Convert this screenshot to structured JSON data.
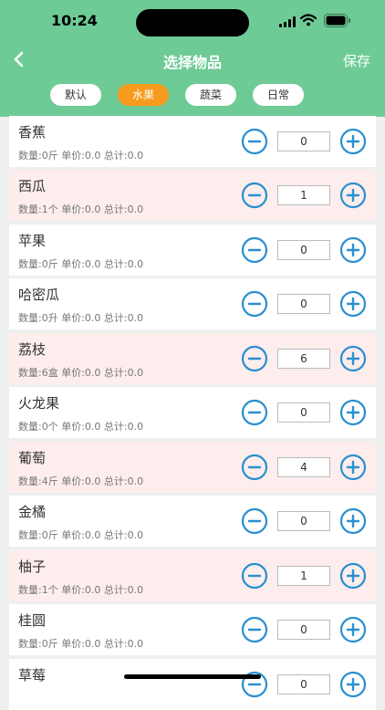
{
  "status": {
    "time": "10:24"
  },
  "nav": {
    "title": "选择物品",
    "save_label": "保存"
  },
  "tabs": [
    {
      "label": "默认",
      "active": false
    },
    {
      "label": "水果",
      "active": true
    },
    {
      "label": "蔬菜",
      "active": false
    },
    {
      "label": "日常",
      "active": false
    }
  ],
  "colors": {
    "header": "#6fcb96",
    "active_tab": "#f79b1e",
    "highlight_row": "#fdeded",
    "stepper": "#2a8fd0"
  },
  "items": [
    {
      "name": "香蕉",
      "info": "数量:0斤 单价:0.0 总计:0.0",
      "qty": "0",
      "highlight": false
    },
    {
      "name": "西瓜",
      "info": "数量:1个 单价:0.0 总计:0.0",
      "qty": "1",
      "highlight": true
    },
    {
      "name": "苹果",
      "info": "数量:0斤 单价:0.0 总计:0.0",
      "qty": "0",
      "highlight": false
    },
    {
      "name": "哈密瓜",
      "info": "数量:0升 单价:0.0 总计:0.0",
      "qty": "0",
      "highlight": false
    },
    {
      "name": "荔枝",
      "info": "数量:6盒 单价:0.0 总计:0.0",
      "qty": "6",
      "highlight": true
    },
    {
      "name": "火龙果",
      "info": "数量:0个 单价:0.0 总计:0.0",
      "qty": "0",
      "highlight": false
    },
    {
      "name": "葡萄",
      "info": "数量:4斤 单价:0.0 总计:0.0",
      "qty": "4",
      "highlight": true
    },
    {
      "name": "金橘",
      "info": "数量:0斤 单价:0.0 总计:0.0",
      "qty": "0",
      "highlight": false
    },
    {
      "name": "柚子",
      "info": "数量:1个 单价:0.0 总计:0.0",
      "qty": "1",
      "highlight": true
    },
    {
      "name": "桂圆",
      "info": "数量:0斤 单价:0.0 总计:0.0",
      "qty": "0",
      "highlight": false
    },
    {
      "name": "草莓",
      "info": "",
      "qty": "0",
      "highlight": false
    }
  ]
}
